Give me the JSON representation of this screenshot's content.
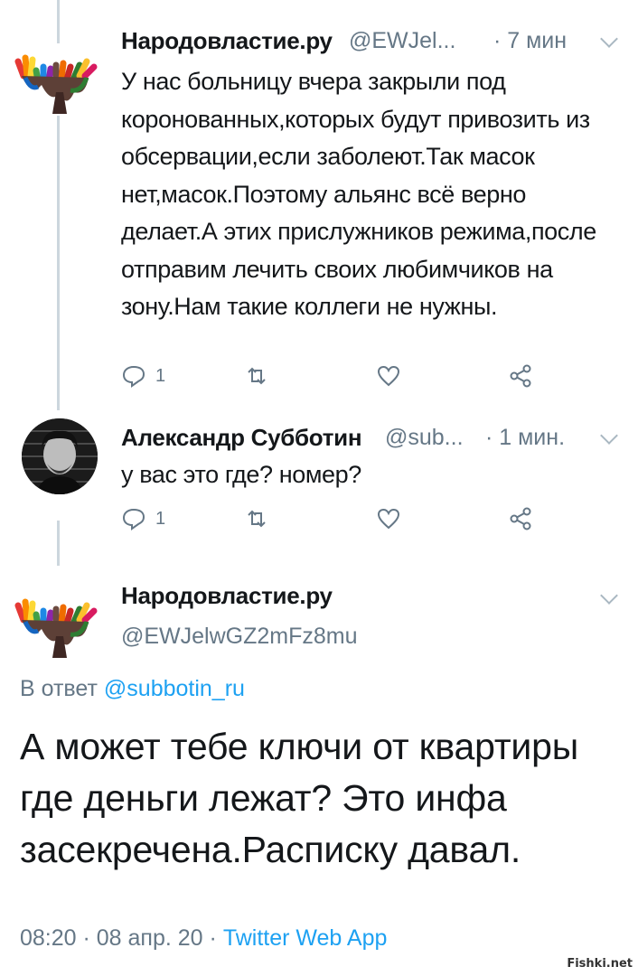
{
  "tweets": [
    {
      "name": "Народовластие.ру",
      "handle": "@EWJel...",
      "time": "· 7 мин",
      "text": "У нас больницу вчера закрыли под коронованных,которых будут привозить из обсервации,если заболеют.Так масок нет,масок.Поэтому альянс всё верно делает.А этих прислужников режима,после отправим лечить своих любимчиков на зону.Нам такие коллеги не нужны.",
      "reply_count": "1"
    },
    {
      "name": "Александр Субботин",
      "handle": "@sub...",
      "time": "· 1 мин.",
      "text": "у вас это где? номер?",
      "reply_count": "1"
    }
  ],
  "main_tweet": {
    "name": "Народовластие.ру",
    "handle": "@EWJelwGZ2mFz8mu",
    "reply_prefix": "В ответ",
    "reply_mention": "@subbotin_ru",
    "text": "А может тебе ключи от квартиры где деньги лежат? Это инфа засекречена.Расписку давал.",
    "timestamp": "08:20 · 08 апр. 20 ·",
    "app": "Twitter Web App"
  },
  "icons": {
    "reply": "reply-icon",
    "retweet": "retweet-icon",
    "like": "heart-icon",
    "share": "share-icon",
    "menu": "chevron-down-icon"
  },
  "colors": {
    "link": "#1da1f2",
    "meta": "#657786",
    "text": "#14171a",
    "thread_line": "#ccd6dd"
  },
  "watermark": "Fishki.net"
}
